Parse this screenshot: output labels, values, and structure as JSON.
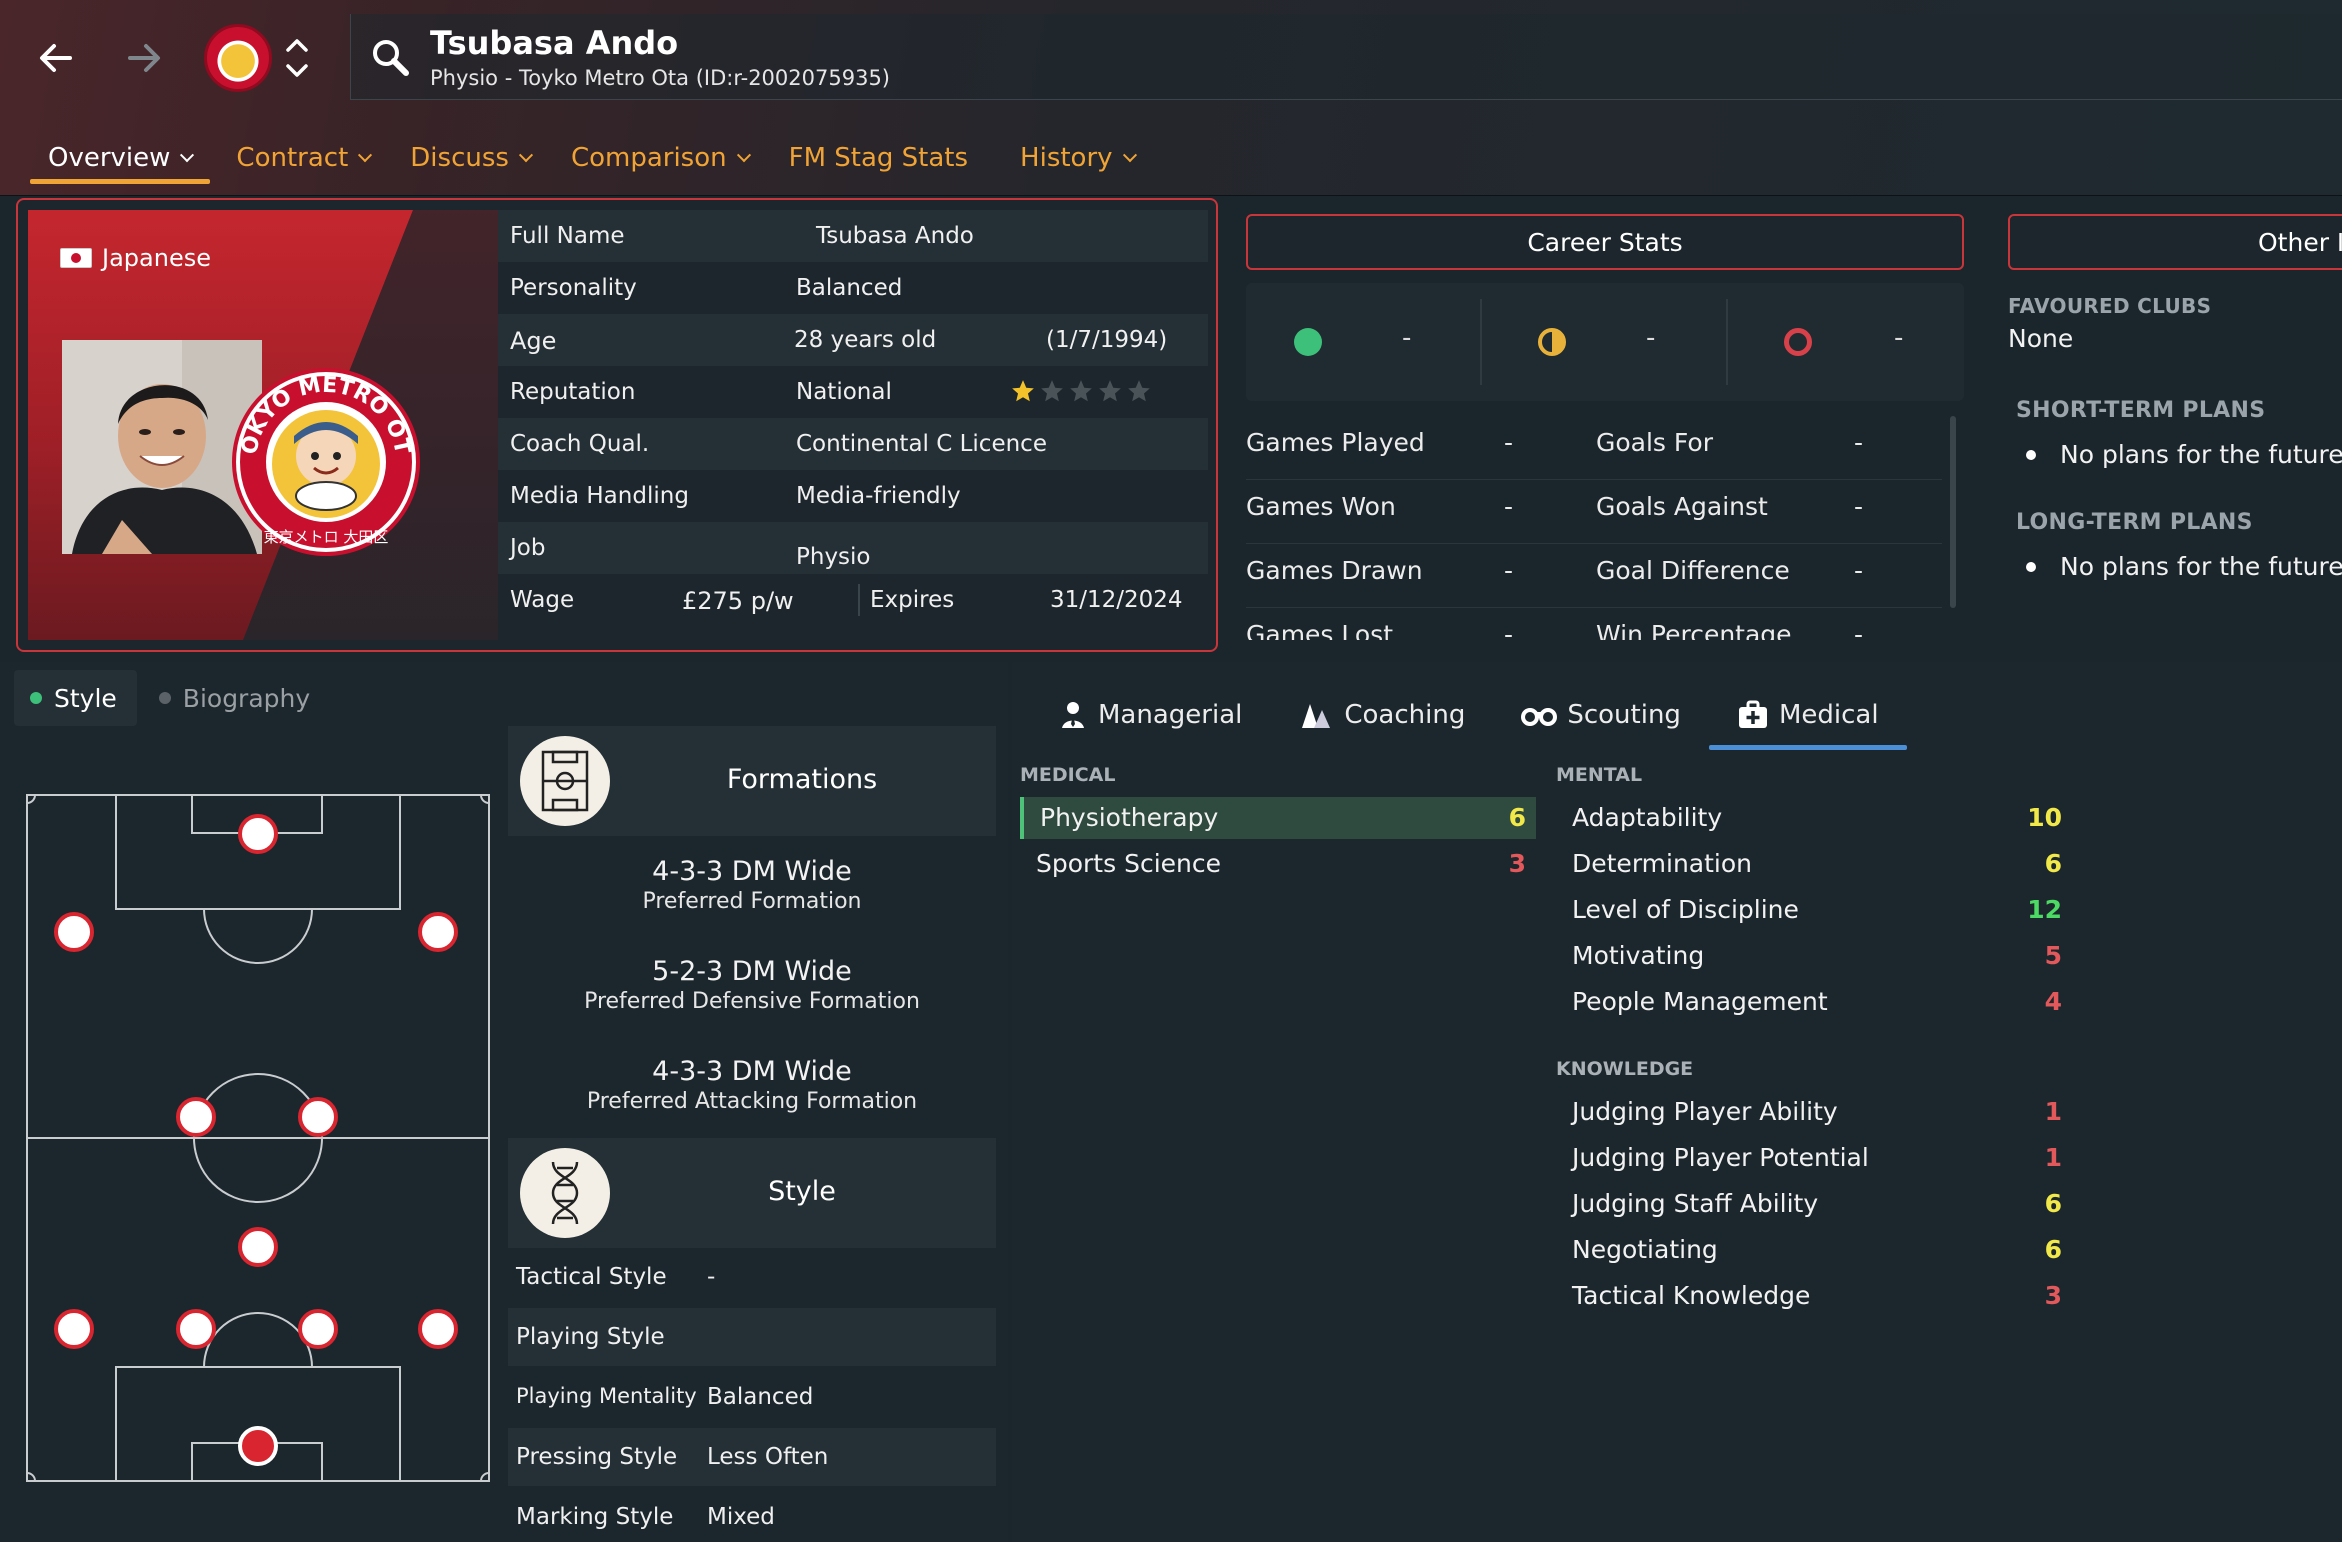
{
  "colors": {
    "accent_orange": "#f0a436",
    "card_border_red": "#c8353a",
    "value_green": "#4cd964",
    "value_yellow": "#f1e94a",
    "value_red": "#e2585b",
    "medical_tab_underline": "#4b8fd6"
  },
  "header": {
    "name": "Tsubasa Ando",
    "subtitle": "Physio - Toyko Metro Ota (ID:r-2002075935)",
    "icons": [
      "back-arrow-icon",
      "forward-arrow-icon",
      "club-logo",
      "up-down-chevron-icon",
      "search-icon"
    ]
  },
  "tabs": [
    {
      "label": "Overview",
      "dropdown": true,
      "active": true
    },
    {
      "label": "Contract",
      "dropdown": true
    },
    {
      "label": "Discuss",
      "dropdown": true
    },
    {
      "label": "Comparison",
      "dropdown": true
    },
    {
      "label": "FM Stag Stats",
      "dropdown": false
    },
    {
      "label": "History",
      "dropdown": true
    }
  ],
  "profile": {
    "nationality": "Japanese",
    "club_logo_text": "TOKYO METRO OTA",
    "club_logo_subtext": "東京メトロ 大田区",
    "full_name_label": "Full Name",
    "full_name": "Tsubasa Ando",
    "personality_label": "Personality",
    "personality": "Balanced",
    "age_label": "Age",
    "age": "28 years old",
    "dob": "(1/7/1994)",
    "reputation_label": "Reputation",
    "reputation": "National",
    "reputation_stars": 1,
    "reputation_stars_max": 5,
    "coach_qual_label": "Coach Qual.",
    "coach_qual": "Continental C Licence",
    "media_label": "Media Handling",
    "media": "Media-friendly",
    "job_label": "Job",
    "job": "Physio",
    "wage_label": "Wage",
    "wage": "£275 p/w",
    "expires_label": "Expires",
    "expires": "31/12/2024"
  },
  "career_stats": {
    "button_label": "Career Stats",
    "form": [
      {
        "icon": "win-dot-icon",
        "color": "#3cc07a",
        "value": "-"
      },
      {
        "icon": "draw-half-dot-icon",
        "color": "#e8b23a",
        "value": "-"
      },
      {
        "icon": "loss-ring-icon",
        "color": "#d9414a",
        "value": "-"
      }
    ],
    "rows": [
      {
        "left_label": "Games Played",
        "left_value": "-",
        "right_label": "Goals For",
        "right_value": "-"
      },
      {
        "left_label": "Games Won",
        "left_value": "-",
        "right_label": "Goals Against",
        "right_value": "-"
      },
      {
        "left_label": "Games Drawn",
        "left_value": "-",
        "right_label": "Goal Difference",
        "right_value": "-"
      },
      {
        "left_label": "Games Lost",
        "left_value": "-",
        "right_label": "Win Percentage",
        "right_value": "-"
      }
    ]
  },
  "other_info": {
    "button_label": "Other I",
    "favoured_clubs_label": "FAVOURED CLUBS",
    "favoured_clubs": "None",
    "short_term_label": "SHORT-TERM PLANS",
    "short_term": "No plans for the future",
    "long_term_label": "LONG-TERM PLANS",
    "long_term": "No plans for the future"
  },
  "lower_tabs": [
    {
      "label": "Style",
      "active": true,
      "dot_color": "#3cc07a"
    },
    {
      "label": "Biography",
      "active": false,
      "dot_color": "#5b6368"
    }
  ],
  "formations": {
    "title": "Formations",
    "items": [
      {
        "name": "4-3-3 DM Wide",
        "desc": "Preferred Formation"
      },
      {
        "name": "5-2-3 DM Wide",
        "desc": "Preferred Defensive Formation"
      },
      {
        "name": "4-3-3 DM Wide",
        "desc": "Preferred Attacking Formation"
      }
    ]
  },
  "style": {
    "title": "Style",
    "rows": [
      {
        "label": "Tactical Style",
        "value": "-"
      },
      {
        "label": "Playing Style",
        "value": ""
      },
      {
        "label": "Playing Mentality",
        "value": "Balanced"
      },
      {
        "label": "Pressing Style",
        "value": "Less Often"
      },
      {
        "label": "Marking Style",
        "value": "Mixed"
      }
    ]
  },
  "attribute_tabs": [
    {
      "label": "Managerial",
      "icon": "manager-icon"
    },
    {
      "label": "Coaching",
      "icon": "coaching-cone-icon"
    },
    {
      "label": "Scouting",
      "icon": "binoculars-icon"
    },
    {
      "label": "Medical",
      "icon": "medical-kit-icon",
      "active": true
    }
  ],
  "attributes": {
    "medical_label": "MEDICAL",
    "medical": [
      {
        "name": "Physiotherapy",
        "value": "6",
        "tier": "yellow",
        "highlight": true
      },
      {
        "name": "Sports Science",
        "value": "3",
        "tier": "red"
      }
    ],
    "mental_label": "MENTAL",
    "mental": [
      {
        "name": "Adaptability",
        "value": "10",
        "tier": "yellow"
      },
      {
        "name": "Determination",
        "value": "6",
        "tier": "yellow"
      },
      {
        "name": "Level of Discipline",
        "value": "12",
        "tier": "green"
      },
      {
        "name": "Motivating",
        "value": "5",
        "tier": "red"
      },
      {
        "name": "People Management",
        "value": "4",
        "tier": "red"
      }
    ],
    "knowledge_label": "KNOWLEDGE",
    "knowledge": [
      {
        "name": "Judging Player Ability",
        "value": "1",
        "tier": "red"
      },
      {
        "name": "Judging Player Potential",
        "value": "1",
        "tier": "red"
      },
      {
        "name": "Judging Staff Ability",
        "value": "6",
        "tier": "yellow"
      },
      {
        "name": "Negotiating",
        "value": "6",
        "tier": "yellow"
      },
      {
        "name": "Tactical Knowledge",
        "value": "3",
        "tier": "red"
      }
    ]
  }
}
